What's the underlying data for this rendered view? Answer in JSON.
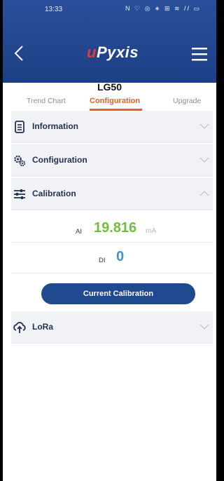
{
  "status_bar": {
    "time": "13:33",
    "icons": "N ♡ ◎ ∗ ⊞ ≋ 𝐼𝐼 ▭"
  },
  "header": {
    "logo_prefix": "u",
    "logo_text": "Pyxis",
    "back_icon": "chevron-left-icon",
    "menu_icon": "hamburger-menu-icon"
  },
  "device": {
    "name": "LG50"
  },
  "tabs": [
    {
      "label": "Trend Chart",
      "active": false
    },
    {
      "label": "Configuration",
      "active": true
    },
    {
      "label": "Upgrade",
      "active": false
    }
  ],
  "sections": {
    "information": {
      "label": "Information",
      "expanded": false,
      "icon": "document-icon"
    },
    "configuration": {
      "label": "Configuration",
      "expanded": false,
      "icon": "settings-icon"
    },
    "calibration": {
      "label": "Calibration",
      "expanded": true,
      "icon": "sliders-icon"
    },
    "lora": {
      "label": "LoRa",
      "expanded": false,
      "icon": "cloud-upload-icon"
    }
  },
  "calibration": {
    "ai_label": "AI",
    "ai_value": "19.816",
    "ai_unit": "mA",
    "di_label": "DI",
    "di_value": "0",
    "button_label": "Current Calibration"
  },
  "colors": {
    "header_bg": "#1d3f86",
    "accent_orange": "#e2622a",
    "ai_green": "#6fbe3c",
    "di_blue": "#3d93d6",
    "button_bg": "#1f4a8f",
    "logo_red": "#e23a36"
  }
}
